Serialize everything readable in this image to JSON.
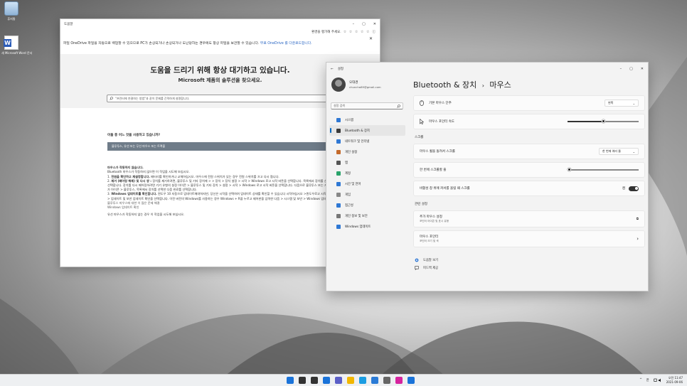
{
  "desktop": {
    "icons": [
      {
        "label": "휴지통"
      },
      {
        "label": "새 Microsoft Word 문서"
      }
    ]
  },
  "help": {
    "title": "도움말",
    "controls": {
      "minimize": "–",
      "maximize": "▢",
      "close": "✕"
    },
    "rate_text": "환경을 평가해 주세요.",
    "stars": "☆ ☆ ☆ ☆ ☆",
    "info": "ⓘ",
    "notice": "파일 OneDrive 파일을 자동으로 백업할 수 있으므로 PC가 손상되거나 손상되거나 도난당하는 경우에도 항상 파일을 보관할 수 있습니다.",
    "notice_link": "무료 OneDrive 를 다운로드합니다.",
    "notice_close": "✕",
    "hero_title": "도움을 드리기 위해 항상 대기하고 있습니다.",
    "hero_sub": "Microsoft 제품의 솔루션을 찾으세요.",
    "search_placeholder": "\"프린터에 연결하는 방법\"과 같이 문제를 간략하게 설명합니다.",
    "question": "이들 중 어느 것을 사용하고 있습니까?",
    "option": "블루투스, 유선 또는 무선 마우스 또는 트랙볼",
    "section_title": "마우스가 작동하지 않습니다.",
    "intro": "Bluetooth 마우스가 작동하지 않으면 이 작업을 시도해 보십시오.",
    "steps": [
      {
        "num": "1.",
        "bold": "전원을 확인하고 재설정합니다.",
        "text": " 배터리를 확인하거나 교체하십시오. 마우스에 전원 스위치가 있는 경우 전원 스위치를 끄고 다시 켭니다."
      },
      {
        "num": "2.",
        "bold": "제거 (페어링 해제) 및 다시 쌍 :",
        "text": " 장치를 제거하려면, 블루투스 및 기타 장치에 > > 장치 > 장치 설정 > 시작 > Windows 로고 시작 버튼을 선택합니다. 목록에서 장치를 선택하고 장치 제거를 선택한 다음 예를 선택합니다. 장치를 다시 페어링하려면 기기 유형의 설정 아이콘 > 블루투스 및 기타 장치 > 설정 > 시작 > Windows 로고 시작 버튼을 선택합니다. 다음으로 블루투스 또는 기타 장치 추가를 선택 플러스 기호 추가 아이콘 > 블루투스, 목록에서 장치를 선택한 다음 완료를 선택합니다."
      },
      {
        "num": "3.",
        "bold": "Windows 업데이트를 확인합니다.",
        "text": " 윈도우 10 자동으로 업데이트해야하지만, 당신은 시작을 선택하여 업데이트 상태를 확인할 수 있습니다 시작하십시오 >윈도우로고 시작 버튼 > 설정 기어모양의 설정 아이콘 > 업데이트 및 보안 업데이트 확인을 선택합니다. 이전 버전의 Windows를 사용하는 경우 Windows + R을 누르고 제어판을 입력한 다음 > 시스템 및 보안 > Windows 업데이트를 선택합니다."
      }
    ],
    "link1": "블루투스 마우스에 대한 이 많은 문제 해결",
    "link2": "Windows 업데이트 확인",
    "wired": "유선 마우스가 작동하지 않는 경우 이 작업을 시도해 보십시오."
  },
  "settings": {
    "back": "←",
    "title": "설정",
    "controls": {
      "minimize": "–",
      "maximize": "▢",
      "close": "✕"
    },
    "profile": {
      "name": "오대경",
      "email": "chuncha89@gmail.com"
    },
    "search_placeholder": "설정 검색",
    "nav": [
      {
        "label": "시스템",
        "color": "#2f78d4"
      },
      {
        "label": "Bluetooth & 장치",
        "color": "#3a3a3a",
        "active": true
      },
      {
        "label": "네트워크 및 인터넷",
        "color": "#2f78d4"
      },
      {
        "label": "개인 설정",
        "color": "#c46a2b"
      },
      {
        "label": "앱",
        "color": "#555"
      },
      {
        "label": "계정",
        "color": "#2aa36b"
      },
      {
        "label": "시간 및 언어",
        "color": "#2f78d4"
      },
      {
        "label": "게임",
        "color": "#888"
      },
      {
        "label": "접근성",
        "color": "#2f78d4"
      },
      {
        "label": "개인 정보 및 보안",
        "color": "#777"
      },
      {
        "label": "Windows 업데이트",
        "color": "#2f78d4"
      }
    ],
    "breadcrumb_parent": "Bluetooth & 장치",
    "breadcrumb_sep": "›",
    "breadcrumb_current": "마우스",
    "primary_button": {
      "label": "기본 마우스 단추",
      "value": "왼쪽"
    },
    "pointer_speed": {
      "label": "마우스 포인터 속도",
      "level": 0.5
    },
    "scroll_header": "스크롤",
    "wheel_scroll": {
      "label": "마우스 휠을 돌려서 스크롤",
      "value": "한 번에 여러 줄"
    },
    "lines_per_scroll": {
      "label": "한 번에 스크롤할 줄",
      "level": 0.02
    },
    "inactive_scroll": {
      "label": "비활성 창 위에 커서를 올릴 때 스크롤",
      "state": "켬"
    },
    "related_header": "관련 설정",
    "related": [
      {
        "label": "추가 마우스 설정",
        "sub": "포인터 아이콘 및 표시 유형",
        "icon": "external-link-icon",
        "glyph": "⧉"
      },
      {
        "label": "마우스 포인터",
        "sub": "포인터 크기 및 색",
        "icon": "chevron-right-icon",
        "glyph": "›"
      }
    ],
    "help_link": "도움말 보기",
    "feedback_link": "피드백 제공"
  },
  "taskbar": {
    "icons": [
      {
        "name": "start-icon",
        "color": "#1a73d9"
      },
      {
        "name": "search-icon",
        "color": "#333"
      },
      {
        "name": "task-view-icon",
        "color": "#333"
      },
      {
        "name": "widgets-icon",
        "color": "#1a73d9"
      },
      {
        "name": "chat-icon",
        "color": "#5b5fc7"
      },
      {
        "name": "file-explorer-icon",
        "color": "#f2b700"
      },
      {
        "name": "edge-icon",
        "color": "#1b9de2"
      },
      {
        "name": "store-icon",
        "color": "#2b7bd6"
      },
      {
        "name": "settings-app-icon",
        "color": "#666"
      },
      {
        "name": "instagram-icon",
        "color": "#d6249f"
      },
      {
        "name": "get-help-icon",
        "color": "#1a73d9"
      }
    ],
    "tray_chevron": "^",
    "lang": "한",
    "time": "오전 11:47",
    "date": "2021-09-06"
  }
}
